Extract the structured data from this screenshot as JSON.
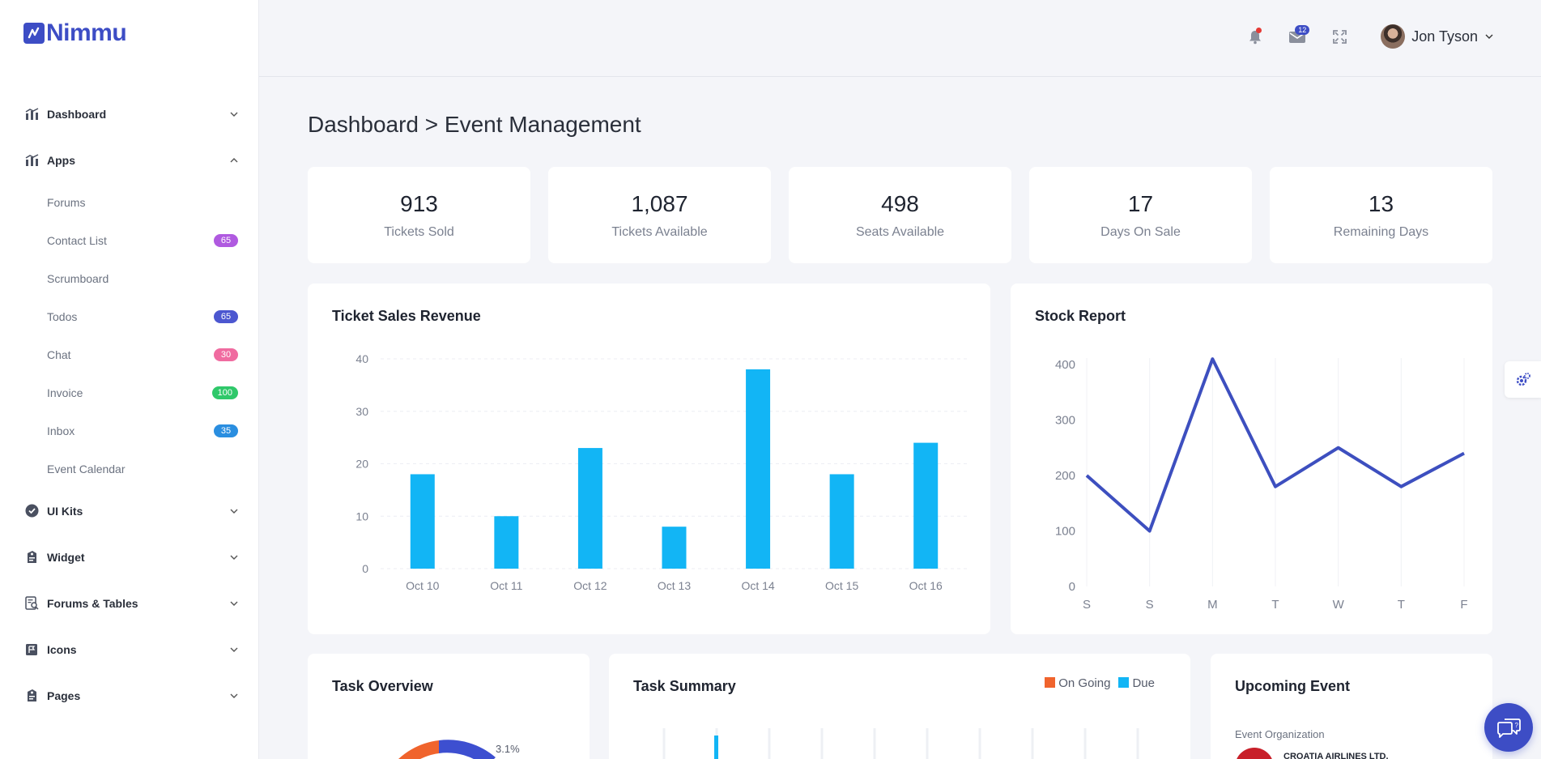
{
  "brand": {
    "name": "Nimmu",
    "color": "#3d4dc5"
  },
  "sidebar": {
    "items": [
      {
        "label": "Dashboard",
        "icon": "chart-icon",
        "expanded": false
      },
      {
        "label": "Apps",
        "icon": "chart-icon",
        "expanded": true,
        "children": [
          {
            "label": "Forums"
          },
          {
            "label": "Contact List",
            "badge": "65",
            "badge_color": "#b05ae0"
          },
          {
            "label": "Scrumboard"
          },
          {
            "label": "Todos",
            "badge": "65",
            "badge_color": "#4c57d0"
          },
          {
            "label": "Chat",
            "badge": "30",
            "badge_color": "#f06ba0"
          },
          {
            "label": "Invoice",
            "badge": "100",
            "badge_color": "#2fc86a"
          },
          {
            "label": "Inbox",
            "badge": "35",
            "badge_color": "#2a8ee0"
          },
          {
            "label": "Event Calendar"
          }
        ]
      },
      {
        "label": "UI Kits",
        "icon": "check-circle-icon",
        "expanded": false
      },
      {
        "label": "Widget",
        "icon": "tag-icon",
        "expanded": false
      },
      {
        "label": "Forums & Tables",
        "icon": "document-search-icon",
        "expanded": false
      },
      {
        "label": "Icons",
        "icon": "flag-icon",
        "expanded": false
      },
      {
        "label": "Pages",
        "icon": "tag-icon",
        "expanded": false
      }
    ]
  },
  "header": {
    "mail_count": "12",
    "user_name": "Jon Tyson"
  },
  "page": {
    "title": "Dashboard > Event Management"
  },
  "stats": [
    {
      "value": "913",
      "label": "Tickets Sold"
    },
    {
      "value": "1,087",
      "label": "Tickets Available"
    },
    {
      "value": "498",
      "label": "Seats Available"
    },
    {
      "value": "17",
      "label": "Days On Sale"
    },
    {
      "value": "13",
      "label": "Remaining Days"
    }
  ],
  "cards": {
    "sales_title": "Ticket Sales Revenue",
    "stock_title": "Stock Report",
    "task_overview_title": "Task Overview",
    "task_summary_title": "Task Summary",
    "upcoming_title": "Upcoming Event",
    "donut_label": "3.1%",
    "legend": [
      {
        "label": "On Going",
        "color": "#f0642d"
      },
      {
        "label": "Due",
        "color": "#12b5f5"
      }
    ],
    "event_org_label": "Event Organization",
    "event_org_name": "CROATIA AIRLINES LTD."
  },
  "chart_data": [
    {
      "type": "bar",
      "title": "Ticket Sales Revenue",
      "categories": [
        "Oct 10",
        "Oct 11",
        "Oct 12",
        "Oct 13",
        "Oct 14",
        "Oct 15",
        "Oct 16"
      ],
      "values": [
        18,
        10,
        23,
        8,
        38,
        18,
        24
      ],
      "ylim": [
        0,
        40
      ],
      "yticks": [
        0,
        10,
        20,
        30,
        40
      ],
      "color": "#12b5f5",
      "grid": true
    },
    {
      "type": "line",
      "title": "Stock Report",
      "categories": [
        "S",
        "S",
        "M",
        "T",
        "W",
        "T",
        "F"
      ],
      "values": [
        200,
        100,
        410,
        180,
        250,
        180,
        240
      ],
      "ylim": [
        0,
        400
      ],
      "yticks": [
        0,
        100,
        200,
        300,
        400
      ],
      "color": "#3d4fbf",
      "grid": true
    }
  ],
  "colors": {
    "accent": "#3d4dc5",
    "bar": "#12b5f5",
    "line": "#3d4fbf",
    "background": "#f4f5f9"
  }
}
